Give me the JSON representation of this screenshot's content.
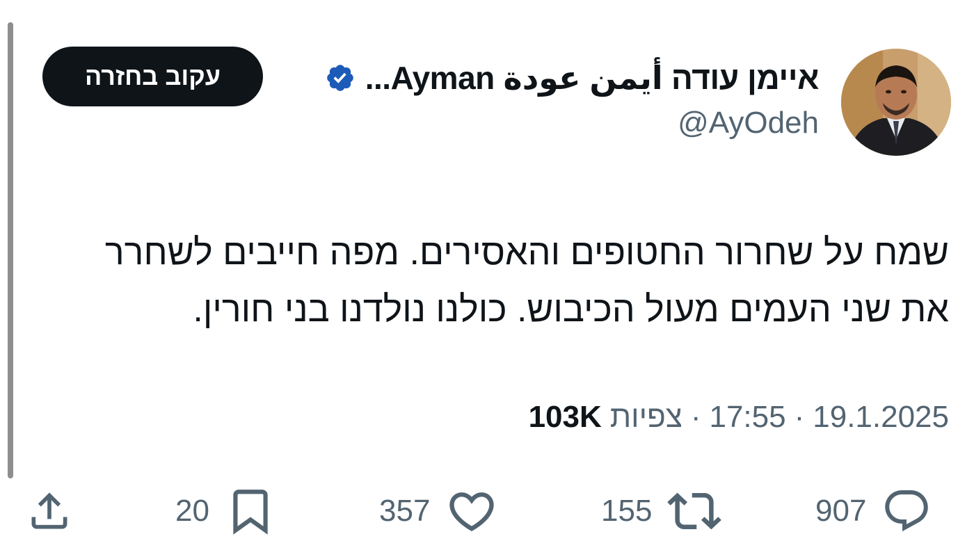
{
  "author": {
    "display_name": "איימן עודה أيمن عودة Ayman...",
    "handle": "@AyOdeh",
    "verified_color": "#1d5bb8"
  },
  "follow_button": {
    "label": "עקוב בחזרה"
  },
  "tweet": {
    "lines": [
      "שמח על שחרור החטופים והאסירים. מפה חייבים לשחרר",
      "את שני העמים מעול הכיבוש. כולנו נולדנו בני חורין."
    ]
  },
  "meta": {
    "date": "19.1.2025",
    "separator": "·",
    "time": "17:55",
    "views_label": "צפיות",
    "views_count": "103K"
  },
  "actions": {
    "replies": "907",
    "retweets": "155",
    "likes": "357",
    "bookmarks": "20",
    "icons": [
      "reply-icon",
      "retweet-icon",
      "like-icon",
      "bookmark-icon",
      "share-icon"
    ]
  },
  "colors": {
    "text_primary": "#0f1419",
    "text_secondary": "#536471",
    "button_bg": "#0f1419"
  }
}
